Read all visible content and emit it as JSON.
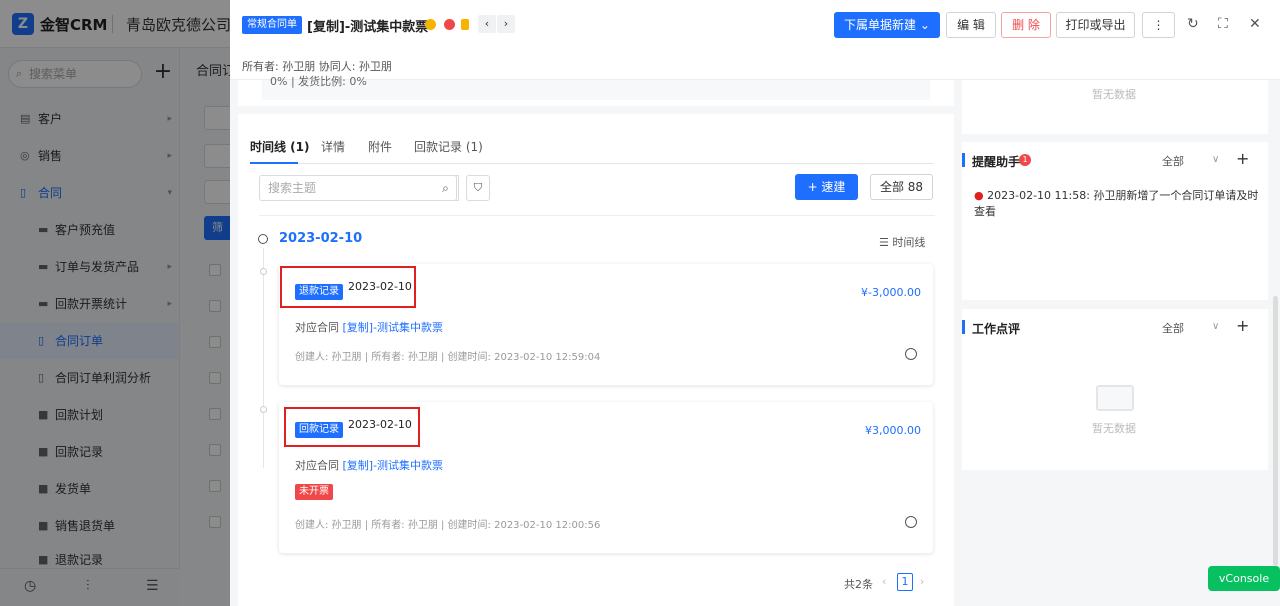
{
  "app": {
    "logo_text": "金智CRM",
    "logo_mark": "Z",
    "company": "青岛欧克德公司"
  },
  "sidebar": {
    "search_placeholder": "搜索菜单",
    "search_icon": "search-icon",
    "add_label": "+",
    "items": [
      {
        "label": "客户",
        "icon": "building-icon",
        "arrow": "▸"
      },
      {
        "label": "销售",
        "icon": "target-icon",
        "arrow": "▸"
      },
      {
        "label": "合同",
        "icon": "document-icon",
        "arrow": "▾"
      },
      {
        "label": "客户预充值",
        "icon": "folder-icon"
      },
      {
        "label": "订单与发货产品",
        "icon": "folder-icon",
        "arrow": "▸"
      },
      {
        "label": "回款开票统计",
        "icon": "folder-icon",
        "arrow": "▸"
      },
      {
        "label": "合同订单",
        "icon": "document-icon"
      },
      {
        "label": "合同订单利润分析",
        "icon": "document-icon"
      },
      {
        "label": "回款计划",
        "icon": "box-icon"
      },
      {
        "label": "回款记录",
        "icon": "box-icon"
      },
      {
        "label": "发货单",
        "icon": "box-icon"
      },
      {
        "label": "销售退货单",
        "icon": "box-icon"
      },
      {
        "label": "退款记录",
        "icon": "box-icon"
      }
    ],
    "footer": [
      "history-icon",
      "settings-icon",
      "list-icon"
    ]
  },
  "background_page": {
    "tab_label": "合同订",
    "filter_button": "筛",
    "input_stub": "自动"
  },
  "drawer": {
    "type_tag": "常规合同单",
    "title": "[复制]-测试集中款票",
    "owners": "所有者: 孙卫朋  协同人: 孙卫朋",
    "nav_prev": "‹",
    "nav_next": "›",
    "actions": {
      "new_sub": "下属单据新建",
      "edit": "编 辑",
      "delete": "删 除",
      "print": "打印或导出",
      "more": "⋮"
    },
    "toolbar_icons": [
      "refresh-icon",
      "fullscreen-icon",
      "close-icon"
    ],
    "prev_section_text": "0% |   发货比例: 0%",
    "tabs": [
      "时间线 (1)",
      "详情",
      "附件",
      "回款记录 (1)"
    ],
    "search_placeholder": "搜索主题",
    "quick_create": "+ 速建",
    "all_button": "全部 88",
    "timeline_date": "2023-02-10",
    "timeline_view": "时间线",
    "records": [
      {
        "tag": "退款记录",
        "date": "2023-02-10",
        "amount": "¥-3,000.00",
        "contract_prefix": "对应合同 ",
        "contract_link": "[复制]-测试集中款票",
        "status": "",
        "meta": "创建人: 孙卫朋  |  所有者: 孙卫朋  |  创建时间: 2023-02-10 12:59:04"
      },
      {
        "tag": "回款记录",
        "date": "2023-02-10",
        "amount": "¥3,000.00",
        "contract_prefix": "对应合同 ",
        "contract_link": "[复制]-测试集中款票",
        "status": "未开票",
        "meta": "创建人: 孙卫朋  |  所有者: 孙卫朋  |  创建时间: 2023-02-10 12:00:56"
      }
    ],
    "pager": {
      "total": "共2条",
      "current": "1",
      "prev": "‹",
      "next": "›"
    }
  },
  "right": {
    "top_nodata": "暂无数据",
    "reminder": {
      "title": "提醒助手",
      "badge": "1",
      "filter": "全部",
      "add": "+",
      "chevron": "∨",
      "item": "2023-02-10 11:58: 孙卫朋新增了一个合同订单请及时查看"
    },
    "review": {
      "title": "工作点评",
      "filter": "全部",
      "add": "+",
      "chevron": "∨",
      "nodata": "暂无数据"
    }
  },
  "vconsole": "vConsole",
  "colors": {
    "primary": "#1e6fff",
    "danger": "#f04848",
    "highlight": "#e02020",
    "vconsole": "#07c160"
  }
}
